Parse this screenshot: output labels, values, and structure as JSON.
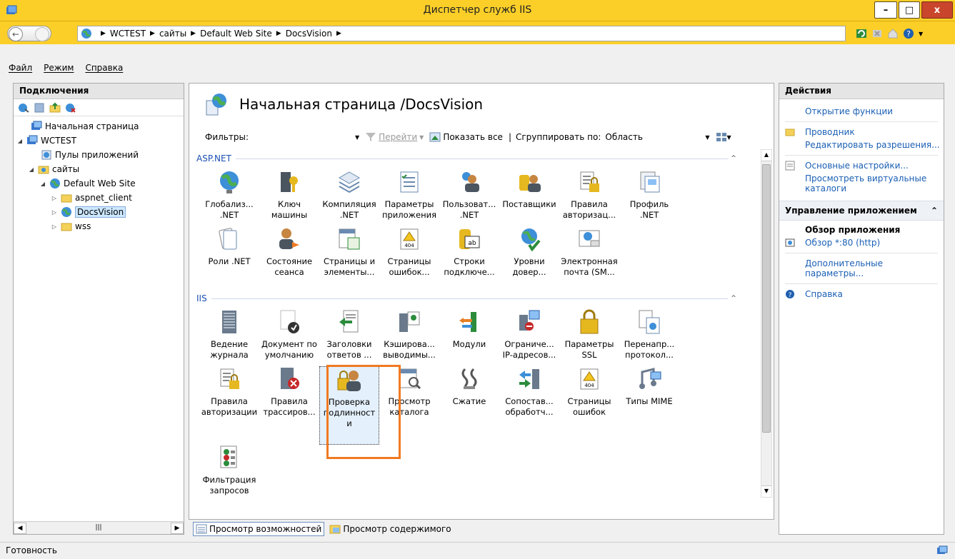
{
  "window": {
    "title": "Диспетчер служб IIS",
    "btn_min": "–",
    "btn_max": "□",
    "btn_close": "x"
  },
  "address": {
    "crumbs": [
      "WCTEST",
      "сайты",
      "Default Web Site",
      "DocsVision"
    ]
  },
  "menu": {
    "items": [
      "Файл",
      "Режим",
      "Справка"
    ]
  },
  "connections": {
    "title": "Подключения",
    "tree": [
      {
        "label": "Начальная страница",
        "icon": "start-page-icon",
        "level": 0
      },
      {
        "label": "WCTEST",
        "icon": "server-icon",
        "level": 0,
        "expanded": true
      },
      {
        "label": "Пулы приложений",
        "icon": "app-pools-icon",
        "level": 1
      },
      {
        "label": "сайты",
        "icon": "sites-folder-icon",
        "level": 1,
        "expanded": true
      },
      {
        "label": "Default Web Site",
        "icon": "globe-icon",
        "level": 2,
        "expanded": true
      },
      {
        "label": "aspnet_client",
        "icon": "folder-icon",
        "level": 3,
        "expanded": false
      },
      {
        "label": "DocsVision",
        "icon": "web-app-icon",
        "level": 3,
        "expanded": false,
        "selected": true
      },
      {
        "label": "wss",
        "icon": "folder-icon",
        "level": 3,
        "expanded": false
      }
    ]
  },
  "center": {
    "page_title": "Начальная страница /DocsVision",
    "filters": {
      "label": "Фильтры:",
      "go_label": "Перейти",
      "show_all_label": "Показать все",
      "group_by_label": "Сгруппировать по:",
      "group_by_value": "Область"
    },
    "groups": [
      {
        "name": "ASP.NET",
        "tiles": [
          {
            "label": "Глобализ... .NET",
            "icon": "globalization-icon"
          },
          {
            "label": "Ключ машины",
            "icon": "machine-key-icon"
          },
          {
            "label": "Компиляция .NET",
            "icon": "compilation-icon"
          },
          {
            "label": "Параметры приложения",
            "icon": "app-settings-icon"
          },
          {
            "label": "Пользоват... .NET",
            "icon": "users-icon"
          },
          {
            "label": "Поставщики",
            "icon": "providers-icon"
          },
          {
            "label": "Правила авторизац...",
            "icon": "authorization-rules-icon"
          },
          {
            "label": "Профиль .NET",
            "icon": "profile-icon"
          },
          {
            "label": "Роли .NET",
            "icon": "roles-icon"
          },
          {
            "label": "Состояние сеанса",
            "icon": "session-state-icon"
          },
          {
            "label": "Страницы и элементы...",
            "icon": "pages-controls-icon"
          },
          {
            "label": "Страницы ошибок...",
            "icon": "error-pages-icon"
          },
          {
            "label": "Строки подключе...",
            "icon": "connection-strings-icon"
          },
          {
            "label": "Уровни довер...",
            "icon": "trust-levels-icon"
          },
          {
            "label": "Электронная почта (SM...",
            "icon": "smtp-email-icon"
          }
        ]
      },
      {
        "name": "IIS",
        "tiles": [
          {
            "label": "Ведение журнала",
            "icon": "logging-icon"
          },
          {
            "label": "Документ по умолчанию",
            "icon": "default-document-icon"
          },
          {
            "label": "Заголовки ответов ...",
            "icon": "response-headers-icon"
          },
          {
            "label": "Кэширова... выводимы...",
            "icon": "output-caching-icon"
          },
          {
            "label": "Модули",
            "icon": "modules-icon"
          },
          {
            "label": "Ограниче... IP-адресов...",
            "icon": "ip-restrictions-icon"
          },
          {
            "label": "Параметры SSL",
            "icon": "ssl-lock-icon"
          },
          {
            "label": "Перенапр... протокол...",
            "icon": "http-redirect-icon"
          },
          {
            "label": "Правила авторизации",
            "icon": "authorization-rules-icon"
          },
          {
            "label": "Правила трассиров...",
            "icon": "failed-request-tracing-icon"
          },
          {
            "label": "Проверка подлинност и",
            "icon": "authentication-icon",
            "focused": true
          },
          {
            "label": "Просмотр каталога",
            "icon": "directory-browsing-icon"
          },
          {
            "label": "Сжатие",
            "icon": "compression-icon"
          },
          {
            "label": "Сопостав... обработч...",
            "icon": "handler-mappings-icon"
          },
          {
            "label": "Страницы ошибок",
            "icon": "error-pages-icon"
          },
          {
            "label": "Типы MIME",
            "icon": "mime-types-icon"
          },
          {
            "label": "Фильтрация запросов",
            "icon": "request-filtering-icon"
          }
        ]
      }
    ],
    "view_tabs": [
      "Просмотр возможностей",
      "Просмотр содержимого"
    ]
  },
  "actions": {
    "title": "Действия",
    "top_links": [
      {
        "label": "Открытие функции",
        "icon": ""
      },
      {
        "label": "Проводник",
        "icon": "explorer-icon"
      },
      {
        "label": "Редактировать разрешения...",
        "icon": ""
      }
    ],
    "settings_link": {
      "label": "Основные настройки...",
      "icon": "settings-icon"
    },
    "virtual_dirs_link": "Просмотреть виртуальные каталоги",
    "manage_section": {
      "title": "Управление приложением",
      "browse_header": "Обзор приложения",
      "browse_link": "Обзор *:80 (http)",
      "advanced_link": "Дополнительные параметры..."
    },
    "help_link": "Справка"
  },
  "status": {
    "text": "Готовность"
  },
  "colors": {
    "titlebar": "#fccf28",
    "highlight": "#f07a21",
    "link": "#1a5fb4",
    "group_header": "#1a4fb5"
  }
}
